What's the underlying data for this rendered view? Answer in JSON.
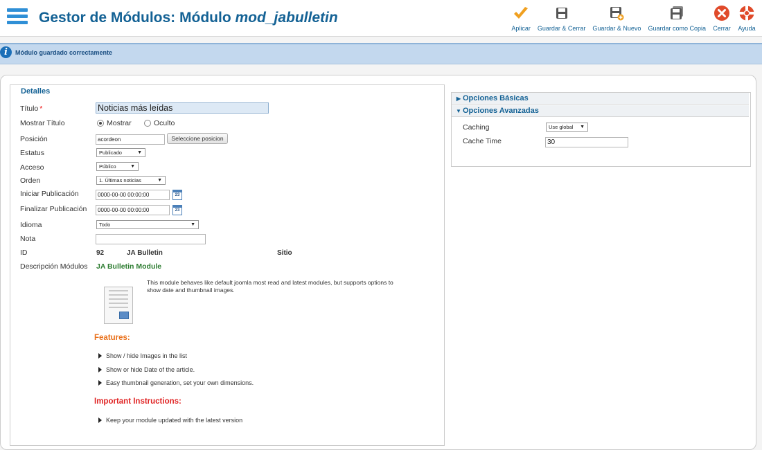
{
  "header": {
    "title": "Gestor de Módulos: Módulo ",
    "title_module": "mod_jabulletin",
    "toolbar": [
      {
        "label": "Aplicar",
        "icon": "apply-check-icon"
      },
      {
        "label": "Guardar & Cerrar",
        "icon": "save-close-icon"
      },
      {
        "label": "Guardar & Nuevo",
        "icon": "save-new-icon"
      },
      {
        "label": "Guardar como Copia",
        "icon": "save-copy-icon"
      },
      {
        "label": "Cerrar",
        "icon": "close-icon"
      },
      {
        "label": "Ayuda",
        "icon": "help-lifebuoy-icon"
      }
    ]
  },
  "message": {
    "text": "Módulo guardado correctamente"
  },
  "details": {
    "legend": "Detalles",
    "titulo_label": "Título",
    "required_mark": "*",
    "titulo_value": "Noticias más leídas",
    "mostrar_titulo_label": "Mostrar Título",
    "mostrar_label": "Mostrar",
    "oculto_label": "Oculto",
    "posicion_label": "Posición",
    "posicion_value": "acordeon",
    "seleccione_btn": "Seleccione posicion",
    "estatus_label": "Estatus",
    "estatus_value": "Publicado",
    "acceso_label": "Acceso",
    "acceso_value": "Público",
    "orden_label": "Orden",
    "orden_value": "1. Últimas noticias",
    "iniciar_label": "Iniciar Publicación",
    "iniciar_value": "0000-00-00 00:00:00",
    "finalizar_label": "Finalizar Publicación",
    "finalizar_value": "0000-00-00 00:00:00",
    "calendar_num": "23",
    "idioma_label": "Idioma",
    "idioma_value": "Todo",
    "nota_label": "Nota",
    "nota_value": "",
    "id_label": "ID",
    "id_value": "92",
    "id_module": "JA Bulletin",
    "id_site": "Sitio",
    "desc_label": "Descripción Módulos",
    "desc_title": "JA Bulletin Module",
    "desc_text_1": "This module behaves like default joomla most read and latest modules, but supports options to",
    "desc_text_2": "show date and thumbnail images.",
    "features_title": "Features:",
    "features": [
      "Show / hide Images in the list",
      "Show or hide Date of the article.",
      "Easy thumbnail generation, set your own dimensions."
    ],
    "instructions_title": "Important Instructions:",
    "instructions": [
      "Keep your module updated with the latest version"
    ]
  },
  "options": {
    "basicas_label": "Opciones Básicas",
    "avanzadas_label": "Opciones Avanzadas",
    "caching_label": "Caching",
    "caching_value": "Use global",
    "cache_time_label": "Cache Time",
    "cache_time_value": "30"
  },
  "colors": {
    "accent": "#146295",
    "message_bg": "#c3d8ee",
    "apply": "#f0a020",
    "close": "#e04a2a"
  }
}
